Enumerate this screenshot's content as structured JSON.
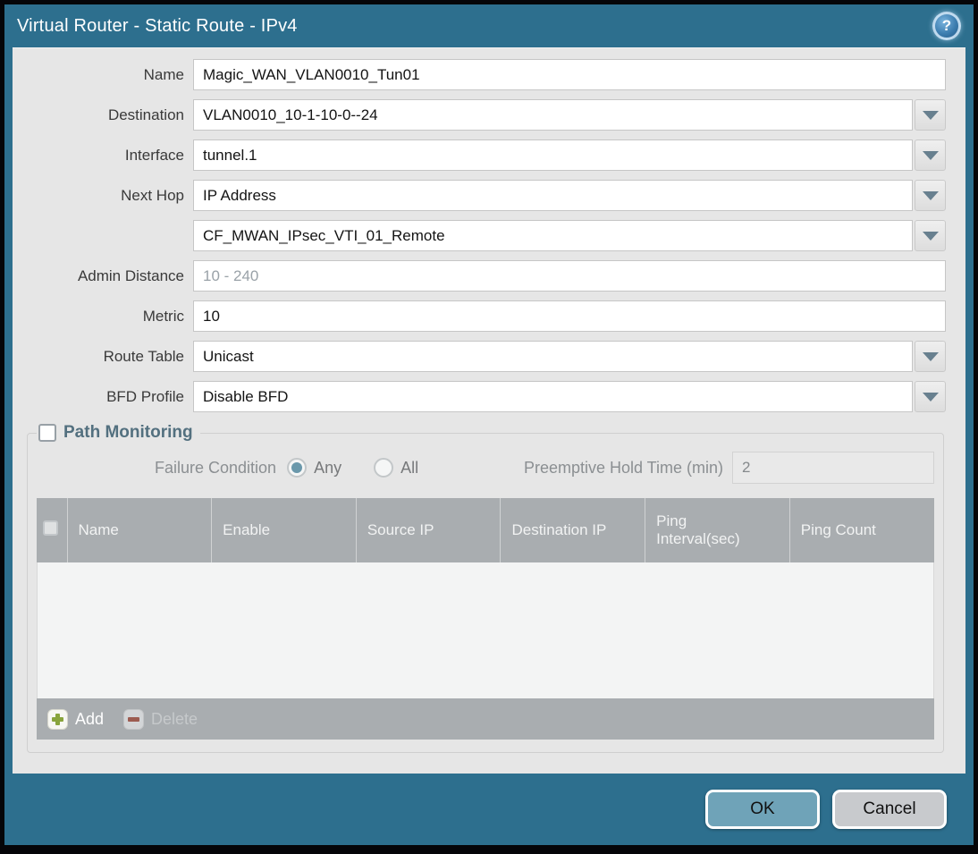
{
  "window": {
    "title": "Virtual Router - Static Route - IPv4"
  },
  "icons": {
    "help": "help-icon",
    "help_glyph": "?",
    "dropdown": "chevron-down-icon",
    "add": "plus-icon",
    "delete": "minus-icon"
  },
  "colors": {
    "titlebar_teal": "#2d6f8e",
    "panel_grey": "#e6e6e6",
    "table_header_grey": "#a9adb0",
    "ok_button_teal": "#6fa3b8",
    "cancel_button_grey": "#c8cacd",
    "add_icon_green": "#88a43c",
    "delete_icon_red": "#9c5b50",
    "help_icon_blue": "#3d7eb0",
    "section_title_slate": "#53707f",
    "radio_selected_teal": "#6a98ab"
  },
  "form": {
    "fields": [
      {
        "label": "Name",
        "value": "Magic_WAN_VLAN0010_Tun01",
        "type": "text"
      },
      {
        "label": "Destination",
        "value": "VLAN0010_10-1-10-0--24",
        "type": "dropdown"
      },
      {
        "label": "Interface",
        "value": "tunnel.1",
        "type": "dropdown"
      },
      {
        "label": "Next Hop",
        "value": "IP Address",
        "type": "dropdown"
      },
      {
        "label": "",
        "value": "CF_MWAN_IPsec_VTI_01_Remote",
        "type": "dropdown"
      },
      {
        "label": "Admin Distance",
        "value": "",
        "placeholder": "10 - 240",
        "type": "text"
      },
      {
        "label": "Metric",
        "value": "10",
        "type": "text"
      },
      {
        "label": "Route Table",
        "value": "Unicast",
        "type": "dropdown"
      },
      {
        "label": "BFD Profile",
        "value": "Disable BFD",
        "type": "dropdown"
      }
    ]
  },
  "path_monitoring": {
    "title": "Path Monitoring",
    "checkbox_checked": false,
    "failure_condition_label": "Failure Condition",
    "options": [
      {
        "label": "Any",
        "selected": true
      },
      {
        "label": "All",
        "selected": false
      }
    ],
    "preemptive_label": "Preemptive Hold Time (min)",
    "preemptive_value": "2",
    "table": {
      "columns": [
        "Name",
        "Enable",
        "Source IP",
        "Destination IP",
        "Ping Interval(sec)",
        "Ping Count"
      ],
      "rows": []
    },
    "add_label": "Add",
    "delete_label": "Delete"
  },
  "footer": {
    "ok_label": "OK",
    "cancel_label": "Cancel"
  }
}
